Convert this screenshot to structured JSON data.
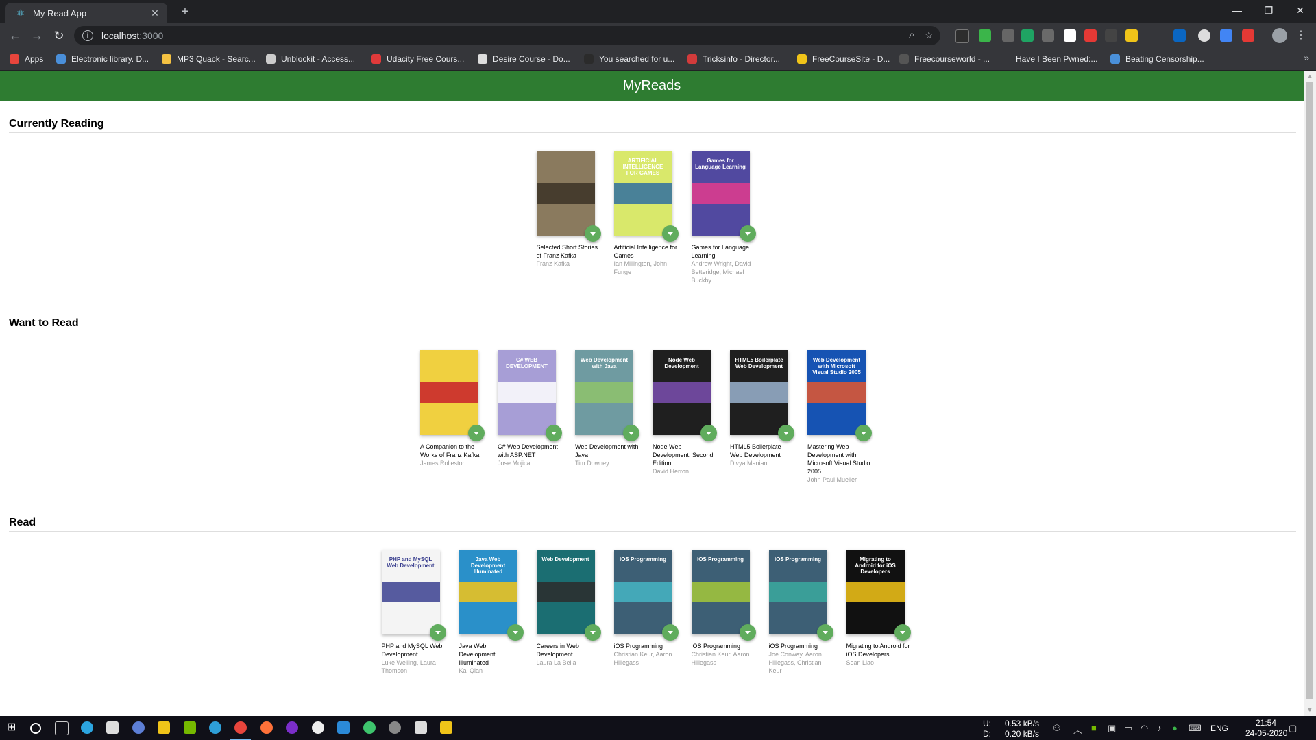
{
  "browser": {
    "tab_title": "My Read App",
    "close_glyph": "✕",
    "new_tab_glyph": "+",
    "url_host": "localhost",
    "url_port": ":3000",
    "bookmarks": [
      {
        "label": "Apps",
        "color": "#e8453c"
      },
      {
        "label": "Electronic library. D...",
        "color": "#4a8fd9"
      },
      {
        "label": "MP3 Quack - Searc...",
        "color": "#f5c242"
      },
      {
        "label": "Unblockit - Access...",
        "color": "#cccccc"
      },
      {
        "label": "Udacity Free Cours...",
        "color": "#e03a3a"
      },
      {
        "label": "Desire Course - Do...",
        "color": "#dddddd"
      },
      {
        "label": "You searched for u...",
        "color": "#2b2b2b"
      },
      {
        "label": "Tricksinfo - Director...",
        "color": "#d23b3b"
      },
      {
        "label": "FreeCourseSite - D...",
        "color": "#f0c419"
      },
      {
        "label": "Freecourseworld - ...",
        "color": "#555555"
      },
      {
        "label": "Have I Been Pwned:...",
        "color": "#35363a"
      },
      {
        "label": "Beating Censorship...",
        "color": "#4a90d9"
      }
    ],
    "more_glyph": "»"
  },
  "app": {
    "title": "MyReads",
    "add_glyph": "+"
  },
  "shelves": [
    {
      "title": "Currently Reading",
      "books": [
        {
          "title": "Selected Short Stories of Franz Kafka",
          "authors": "Franz Kafka",
          "cover_bg": "#8a7a5e",
          "cover_fg": "#3b3226",
          "cover_text": ""
        },
        {
          "title": "Artificial Intelligence for Games",
          "authors": "Ian Millington, John Funge",
          "cover_bg": "#d9e86b",
          "cover_fg": "#2f6fa0",
          "cover_text": "ARTIFICIAL INTELLIGENCE FOR GAMES"
        },
        {
          "title": "Games for Language Learning",
          "authors": "Andrew Wright, David Betteridge, Michael Buckby",
          "cover_bg": "#5149a0",
          "cover_fg": "#e23b8d",
          "cover_text": "Games for Language Learning"
        }
      ]
    },
    {
      "title": "Want to Read",
      "books": [
        {
          "title": "A Companion to the Works of Franz Kafka",
          "authors": "James Rolleston",
          "cover_bg": "#f0d040",
          "cover_fg": "#c8202c",
          "cover_text": ""
        },
        {
          "title": "C# Web Development with ASP.NET",
          "authors": "Jose Mojica",
          "cover_bg": "#a79ed6",
          "cover_fg": "#ffffff",
          "cover_text": "C# WEB DEVELOPMENT"
        },
        {
          "title": "Web Development with Java",
          "authors": "Tim Downey",
          "cover_bg": "#6f9ba1",
          "cover_fg": "#8fc36b",
          "cover_text": "Web Development with Java"
        },
        {
          "title": "Node Web Development, Second Edition",
          "authors": "David Herron",
          "cover_bg": "#1f1f1f",
          "cover_fg": "#7b4fb0",
          "cover_text": "Node Web Development"
        },
        {
          "title": "HTML5 Boilerplate Web Development",
          "authors": "Divya Manian",
          "cover_bg": "#1f1f1f",
          "cover_fg": "#9bb4d0",
          "cover_text": "HTML5 Boilerplate Web Development"
        },
        {
          "title": "Mastering Web Development with Microsoft Visual Studio 2005",
          "authors": "John Paul Mueller",
          "cover_bg": "#1653b3",
          "cover_fg": "#e4572e",
          "cover_text": "Web Development with Microsoft Visual Studio 2005"
        }
      ]
    },
    {
      "title": "Read",
      "books": [
        {
          "title": "PHP and MySQL Web Development",
          "authors": "Luke Welling, Laura Thomson",
          "cover_bg": "#f4f4f4",
          "cover_fg": "#3a3f8f",
          "cover_text": "PHP and MySQL Web Development"
        },
        {
          "title": "Java Web Development Illuminated",
          "authors": "Kai Qian",
          "cover_bg": "#2a90c9",
          "cover_fg": "#f5c518",
          "cover_text": "Java Web Development Illuminated"
        },
        {
          "title": "Careers in Web Development",
          "authors": "Laura La Bella",
          "cover_bg": "#1b6e72",
          "cover_fg": "#2b2b2b",
          "cover_text": "Web Development"
        },
        {
          "title": "iOS Programming",
          "authors": "Christian Keur, Aaron Hillegass",
          "cover_bg": "#3d5f75",
          "cover_fg": "#45b5c4",
          "cover_text": "iOS Programming"
        },
        {
          "title": "iOS Programming",
          "authors": "Christian Keur, Aaron Hillegass",
          "cover_bg": "#3d5f75",
          "cover_fg": "#a5c83a",
          "cover_text": "iOS Programming"
        },
        {
          "title": "iOS Programming",
          "authors": "Joe Conway, Aaron Hillegass, Christian Keur",
          "cover_bg": "#3d5f75",
          "cover_fg": "#3aa99f",
          "cover_text": "iOS Programming"
        },
        {
          "title": "Migrating to Android for iOS Developers",
          "authors": "Sean Liao",
          "cover_bg": "#111111",
          "cover_fg": "#f5c518",
          "cover_text": "Migrating to Android for iOS Developers"
        }
      ]
    }
  ],
  "taskbar": {
    "upload_label": "U:",
    "upload_value": "0.53 kB/s",
    "download_label": "D:",
    "download_value": "0.20 kB/s",
    "language": "ENG",
    "time": "21:54",
    "date": "24-05-2020"
  }
}
